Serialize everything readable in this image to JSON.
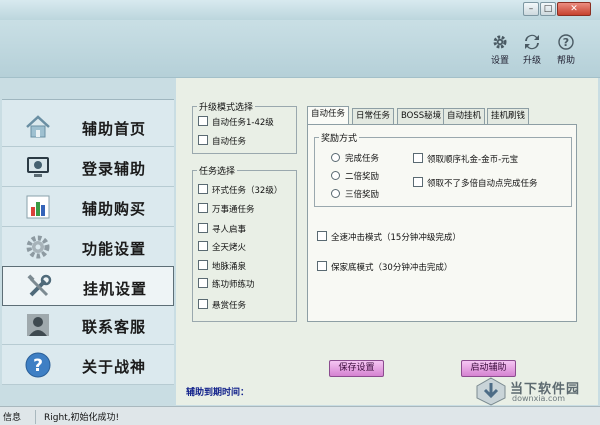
{
  "window": {
    "min": "–",
    "max": "□",
    "close": "✕"
  },
  "toolbar": {
    "settings": "设置",
    "upgrade": "升级",
    "help": "帮助"
  },
  "sidebar": {
    "items": [
      {
        "label": "辅助首页",
        "icon": "home-icon"
      },
      {
        "label": "登录辅助",
        "icon": "monitor-icon"
      },
      {
        "label": "辅助购买",
        "icon": "chart-icon"
      },
      {
        "label": "功能设置",
        "icon": "gear-icon"
      },
      {
        "label": "挂机设置",
        "icon": "tools-icon",
        "active": true
      },
      {
        "label": "联系客服",
        "icon": "person-icon"
      },
      {
        "label": "关于战神",
        "icon": "question-icon"
      }
    ]
  },
  "upgrade_mode": {
    "title": "升级模式选择",
    "options": [
      "自动任务1-42级",
      "自动任务"
    ]
  },
  "task_select": {
    "title": "任务选择",
    "options": [
      "环式任务（32级）",
      "万事通任务",
      "寻人启事",
      "全天烤火",
      "地脉涌泉",
      "练功师练功",
      "悬赏任务"
    ]
  },
  "tabs": [
    "自动任务",
    "日常任务",
    "BOSS秘境",
    "自动挂机",
    "挂机刷钱"
  ],
  "reward": {
    "title": "奖励方式",
    "radios": [
      "完成任务",
      "二倍奖励",
      "三倍奖励"
    ],
    "checks": [
      "领取顺序礼金-金币-元宝",
      "领取不了多倍自动点完成任务"
    ]
  },
  "modes": [
    "全速冲击模式（15分钟冲级完成）",
    "保家底模式（30分钟冲击完成）"
  ],
  "buttons": {
    "save": "保存设置",
    "start": "启动辅助"
  },
  "expiry_label": "辅助到期时间：",
  "status": {
    "label": "信息",
    "message": "Right,初始化成功!"
  },
  "watermark": {
    "name": "当下软件园",
    "url": "downxia.com"
  },
  "colors": {
    "accent": "#c9dde3",
    "button": "#e8a3e4"
  }
}
